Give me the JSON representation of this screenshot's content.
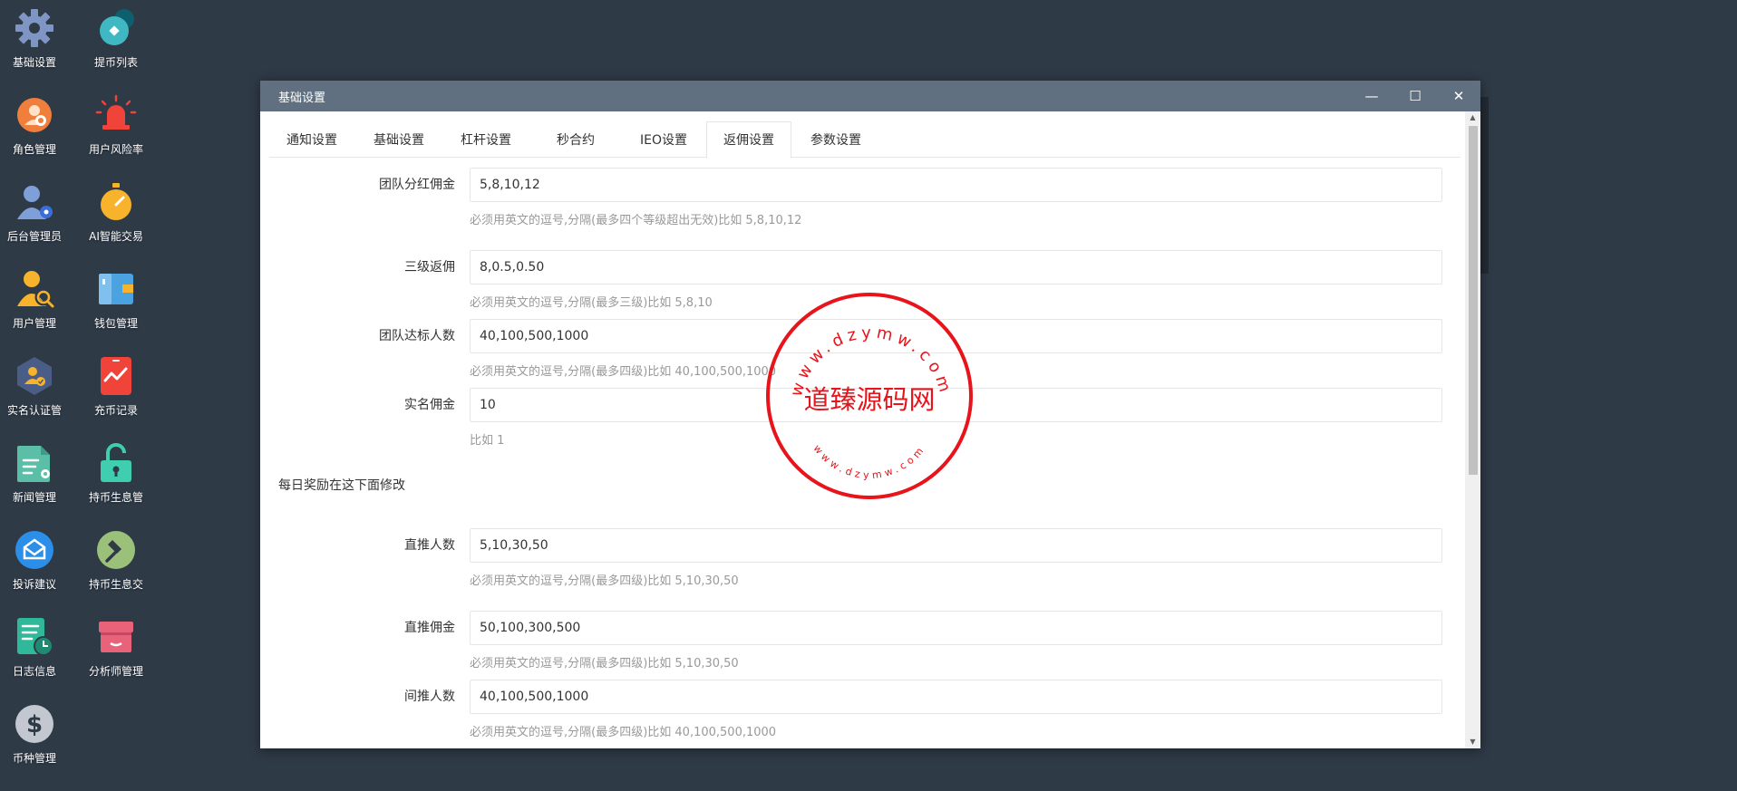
{
  "desktop_icons": [
    {
      "label": "基础设置",
      "icon": "gear-icon"
    },
    {
      "label": "提币列表",
      "icon": "coin-withdraw-icon"
    },
    {
      "label": "角色管理",
      "icon": "role-icon"
    },
    {
      "label": "用户风险率",
      "icon": "alarm-icon"
    },
    {
      "label": "后台管理员",
      "icon": "admin-icon"
    },
    {
      "label": "AI智能交易",
      "icon": "stopwatch-icon"
    },
    {
      "label": "用户管理",
      "icon": "user-search-icon"
    },
    {
      "label": "钱包管理",
      "icon": "wallet-icon"
    },
    {
      "label": "实名认证管",
      "icon": "verify-icon"
    },
    {
      "label": "充币记录",
      "icon": "chart-phone-icon"
    },
    {
      "label": "新闻管理",
      "icon": "news-icon"
    },
    {
      "label": "持币生息管",
      "icon": "unlock-icon"
    },
    {
      "label": "投诉建议",
      "icon": "mail-icon"
    },
    {
      "label": "持币生息交",
      "icon": "hammer-icon"
    },
    {
      "label": "日志信息",
      "icon": "log-icon"
    },
    {
      "label": "分析师管理",
      "icon": "shop-icon"
    },
    {
      "label": "币种管理",
      "icon": "dollar-icon"
    }
  ],
  "window": {
    "title": "基础设置",
    "minimize": "—",
    "maximize": "☐",
    "close": "✕"
  },
  "tabs": [
    {
      "label": "通知设置"
    },
    {
      "label": "基础设置"
    },
    {
      "label": "杠杆设置"
    },
    {
      "label": "秒合约"
    },
    {
      "label": "IEO设置"
    },
    {
      "label": "返佣设置"
    },
    {
      "label": "参数设置"
    }
  ],
  "active_tab": "返佣设置",
  "form": {
    "team_bonus": {
      "label": "团队分红佣金",
      "value": "5,8,10,12",
      "hint": "必须用英文的逗号,分隔(最多四个等级超出无效)比如 5,8,10,12"
    },
    "three_level": {
      "label": "三级返佣",
      "value": "8,0.5,0.50",
      "hint": "必须用英文的逗号,分隔(最多三级)比如 5,8,10"
    },
    "team_target": {
      "label": "团队达标人数",
      "value": "40,100,500,1000",
      "hint": "必须用英文的逗号,分隔(最多四级)比如 40,100,500,1000"
    },
    "realname": {
      "label": "实名佣金",
      "value": "10",
      "hint": "比如 1"
    },
    "daily_section": "每日奖励在这下面修改",
    "direct_count": {
      "label": "直推人数",
      "value": "5,10,30,50",
      "hint": "必须用英文的逗号,分隔(最多四级)比如 5,10,30,50"
    },
    "direct_bonus": {
      "label": "直推佣金",
      "value": "50,100,300,500",
      "hint": "必须用英文的逗号,分隔(最多四级)比如 5,10,30,50"
    },
    "indirect_count": {
      "label": "间推人数",
      "value": "40,100,500,1000",
      "hint": "必须用英文的逗号,分隔(最多四级)比如 40,100,500,1000"
    }
  },
  "stamp": {
    "text": "道臻源码网",
    "ring_top": "www.dzymw.com",
    "ring_bottom": "www.dzymw.com",
    "color": "#e8141c"
  },
  "colors": {
    "desktop_bg": "#2f3a47",
    "titlebar": "#607080"
  }
}
